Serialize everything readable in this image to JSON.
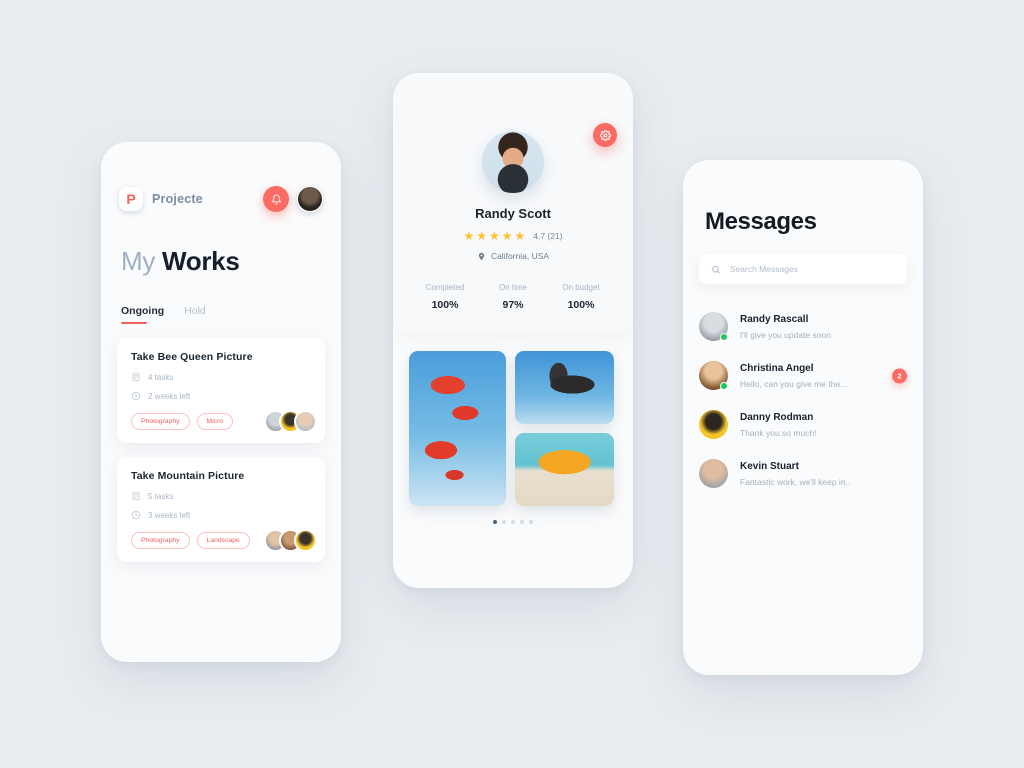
{
  "background_color": "#e9edf1",
  "accent_color": "#f2615a",
  "works_phone": {
    "header": {
      "logo_letter": "P",
      "logo_name": "Projecte",
      "bell_icon": "bell-icon",
      "avatar_icon": "user-avatar"
    },
    "title_light": "My ",
    "title_bold": "Works",
    "tabs": [
      {
        "label": "Ongoing",
        "active": true
      },
      {
        "label": "Hold",
        "active": false
      }
    ],
    "cards": [
      {
        "title": "Take Bee Queen Picture",
        "tasks": "4 tasks",
        "due": "2 weeks left",
        "tags": [
          "Photography",
          "Micro"
        ]
      },
      {
        "title": "Take Mountain Picture",
        "tasks": "5 tasks",
        "due": "3 weeks left",
        "tags": [
          "Photography",
          "Landscape"
        ]
      }
    ]
  },
  "profile_phone": {
    "settings_icon": "gear-icon",
    "avatar_icon": "profile-photo",
    "name": "Randy Scott",
    "stars": 5,
    "rating_text": "4.7 (21)",
    "location_icon": "location-pin-icon",
    "location": "California, USA",
    "stats": [
      {
        "label": "Completed",
        "value": "100%"
      },
      {
        "label": "On time",
        "value": "97%"
      },
      {
        "label": "On budget",
        "value": "100%"
      }
    ],
    "gallery": [
      {
        "name": "parachutes-photo"
      },
      {
        "name": "eagle-photo"
      },
      {
        "name": "beach-umbrella-photo"
      }
    ],
    "pagination": {
      "total": 5,
      "active_index": 0
    }
  },
  "messages_phone": {
    "title": "Messages",
    "search": {
      "icon": "search-icon",
      "value": "",
      "placeholder": "Search Messages"
    },
    "conversations": [
      {
        "name": "Randy Rascall",
        "preview": "I'll give you update soon",
        "online": true,
        "badge": ""
      },
      {
        "name": "Christina Angel",
        "preview": "Hello, can you give me the...",
        "online": true,
        "badge": "2"
      },
      {
        "name": "Danny Rodman",
        "preview": "Thank you so much!",
        "online": false,
        "badge": ""
      },
      {
        "name": "Kevin Stuart",
        "preview": "Fantastic work, we'll keep in..",
        "online": false,
        "badge": ""
      }
    ]
  }
}
